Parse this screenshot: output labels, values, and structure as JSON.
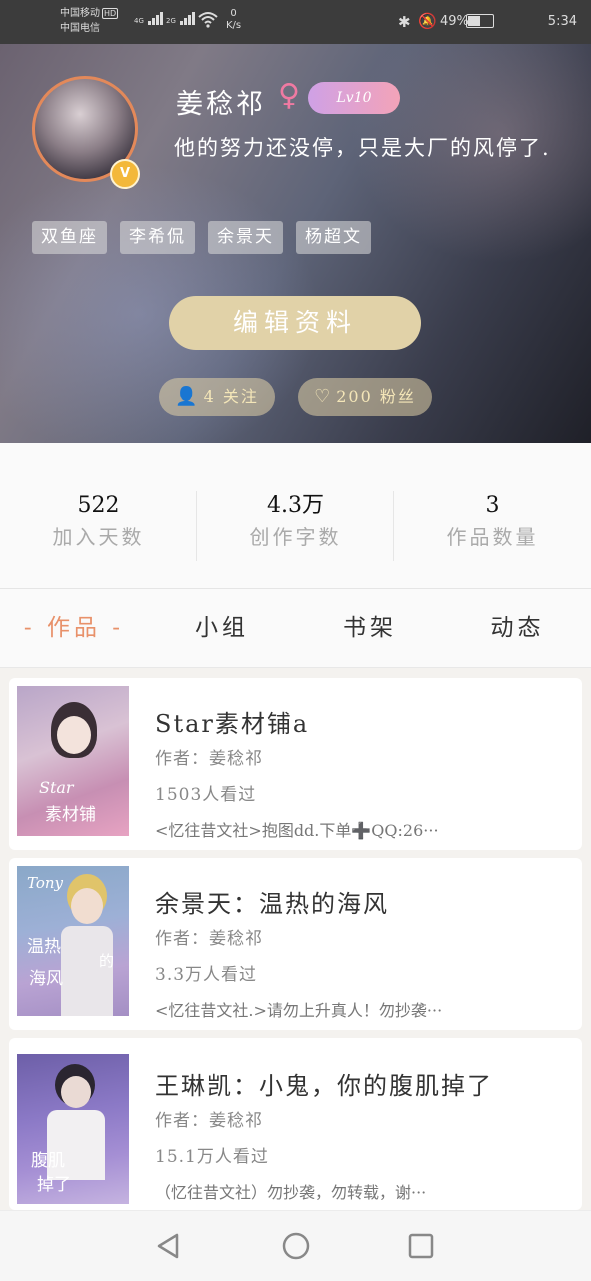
{
  "status_bar": {
    "carrier1": "中国移动",
    "hd": "HD",
    "signal1": "4G",
    "signal2": "2G",
    "carrier2": "中国电信",
    "net_speed": "0",
    "net_unit": "K/s",
    "battery": "49%",
    "time": "5:34"
  },
  "profile": {
    "username": "姜稔祁",
    "gender_icon": "♀",
    "level": "Lv10",
    "vip": "V",
    "bio": "他的努力还没停，只是大厂的风停了.",
    "tags": [
      "双鱼座",
      "李希侃",
      "余景天",
      "杨超文"
    ],
    "edit_label": "编辑资料",
    "following_label": "4 关注",
    "followers_label": "200 粉丝"
  },
  "stats": [
    {
      "value": "522",
      "label": "加入天数"
    },
    {
      "value": "4.3万",
      "label": "创作字数"
    },
    {
      "value": "3",
      "label": "作品数量"
    }
  ],
  "tabs": [
    "- 作品 -",
    "小组",
    "书架",
    "动态"
  ],
  "works": [
    {
      "title": "Star素材铺a",
      "author": "作者：姜稔祁",
      "views": "1503人看过",
      "desc": "<忆往昔文社>抱图dd.下单➕QQ:26···"
    },
    {
      "title": "余景天：温热的海风",
      "author": "作者：姜稔祁",
      "views": "3.3万人看过",
      "desc": "<忆往昔文社.>请勿上升真人！勿抄袭···"
    },
    {
      "title": "王琳凯：小鬼，你的腹肌掉了",
      "author": "作者：姜稔祁",
      "views": "15.1万人看过",
      "desc": "（忆往昔文社）勿抄袭，勿转载，谢···"
    }
  ],
  "cover_texts": [
    "Star",
    "素材铺",
    "Tony",
    "温热",
    "海风",
    "的",
    "腹肌",
    "掉了"
  ],
  "colors": {
    "accent": "#e8916a",
    "edit_button": "#e1d2a8",
    "level_badge": "#cfa1e6",
    "avatar_ring": "#e3895a"
  },
  "icons": [
    "back-icon",
    "home-icon",
    "recents-icon",
    "bluetooth-icon",
    "mute-icon",
    "battery-icon",
    "wifi-icon",
    "follow-icon",
    "heart-icon"
  ]
}
